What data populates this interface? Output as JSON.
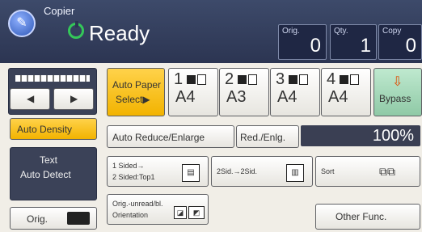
{
  "header": {
    "app_name": "Copier",
    "status": "Ready",
    "counters": [
      {
        "label": "Orig.",
        "value": "0"
      },
      {
        "label": "Qty.",
        "value": "1"
      },
      {
        "label": "Copy",
        "value": "0"
      }
    ]
  },
  "density": {
    "left_arrow": "◀",
    "right_arrow": "▶",
    "auto_density_label": "Auto Density",
    "text_mode_line1": "Text",
    "text_mode_line2": "Auto Detect",
    "orig_label": "Orig."
  },
  "paper": {
    "auto_paper_line1": "Auto Paper",
    "auto_paper_line2": "Select▶",
    "trays": [
      {
        "number": "1",
        "size": "A4"
      },
      {
        "number": "2",
        "size": "A3"
      },
      {
        "number": "3",
        "size": "A4"
      },
      {
        "number": "4",
        "size": "A4"
      }
    ],
    "bypass_label": "Bypass"
  },
  "reduce": {
    "auto_reduce_label": "Auto Reduce/Enlarge",
    "red_enlg_label": "Red./Enlg.",
    "ratio": "100%"
  },
  "duplex": {
    "line1": "1 Sided→",
    "line2": "2 Sided:Top1",
    "combine_label": "2Sid.→2Sid.",
    "sort_label": "Sort"
  },
  "orientation": {
    "line1": "Orig.-unread/bl.",
    "line2": "Orientation",
    "other_func_label": "Other Func."
  },
  "colors": {
    "header_bg": "#2c3552",
    "accent_yellow": "#f2b300",
    "bypass_green": "#8fc9a6"
  }
}
